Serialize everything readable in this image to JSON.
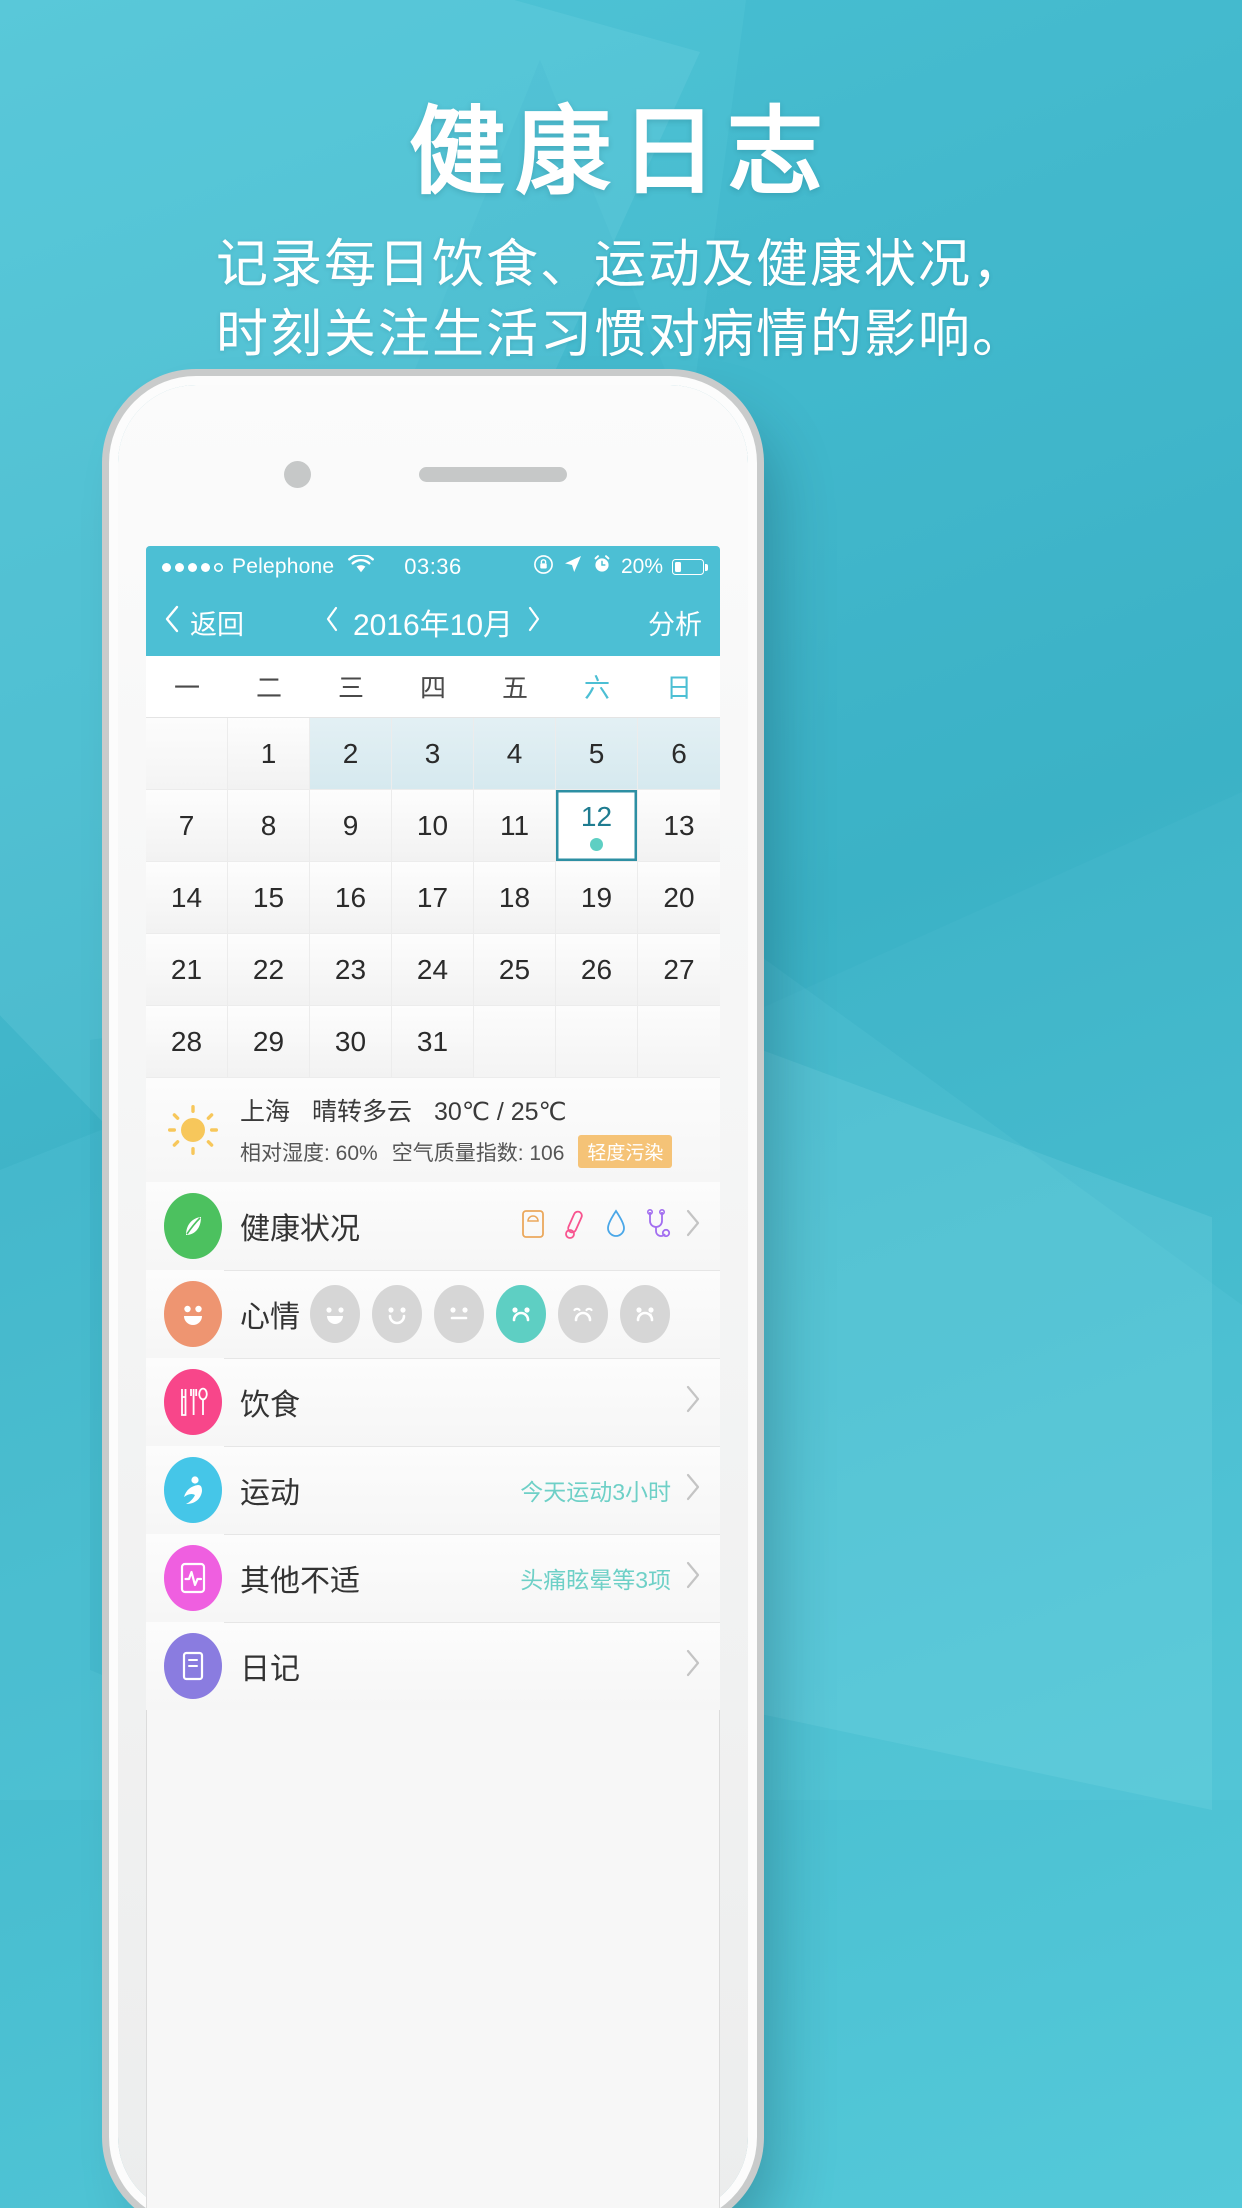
{
  "poster": {
    "title": "健康日志",
    "subtitle_line1": "记录每日饮食、运动及健康状况，",
    "subtitle_line2": "时刻关注生活习惯对病情的影响。",
    "brand_color": "#4cbfd4"
  },
  "status_bar": {
    "carrier": "Pelephone",
    "signal_dots_filled": 4,
    "signal_dots_total": 5,
    "wifi_icon": "wifi-icon",
    "time": "03:36",
    "rotation_lock_icon": "rotation-lock-icon",
    "location_icon": "location-arrow-icon",
    "alarm_icon": "alarm-clock-icon",
    "battery_percent": "20%",
    "battery_level": 20
  },
  "nav": {
    "back_label": "返回",
    "prev_month_icon": "chevron-left-icon",
    "month_title": "2016年10月",
    "next_month_icon": "chevron-right-icon",
    "action_label": "分析"
  },
  "calendar": {
    "weekdays": [
      "一",
      "二",
      "三",
      "四",
      "五",
      "六",
      "日"
    ],
    "weekend_indices": [
      5,
      6
    ],
    "leading_blanks": 1,
    "days": [
      1,
      2,
      3,
      4,
      5,
      6,
      7,
      8,
      9,
      10,
      11,
      12,
      13,
      14,
      15,
      16,
      17,
      18,
      19,
      20,
      21,
      22,
      23,
      24,
      25,
      26,
      27,
      28,
      29,
      30,
      31
    ],
    "tinted_days": [
      2,
      3,
      4,
      5,
      6
    ],
    "selected_day": 12,
    "selected_has_record": true,
    "trailing_blanks": 3,
    "selected_color": "#2d8fa3",
    "marker_color": "#5ecfc3"
  },
  "weather": {
    "icon": "sun-cloud-icon",
    "city": "上海",
    "condition": "晴转多云",
    "temperature": "30℃ / 25℃",
    "humidity_label": "相对湿度: 60%",
    "aqi_label": "空气质量指数: 106",
    "aqi_badge": "轻度污染",
    "aqi_badge_color": "#f5c377"
  },
  "rows": [
    {
      "key": "health",
      "icon": "leaf-icon",
      "icon_color": "#4cc15f",
      "label": "健康状况",
      "value": "",
      "mini_icons": [
        "weight-scale-icon",
        "thermometer-icon",
        "water-drop-icon",
        "stethoscope-icon"
      ],
      "arrow": "chevron-right-icon"
    },
    {
      "key": "mood",
      "icon": "smiley-icon",
      "icon_color": "#ee9571",
      "label": "心情",
      "value": "",
      "moods": [
        "laugh",
        "smile",
        "neutral",
        "sad",
        "cry",
        "tear"
      ],
      "selected_mood_index": 3,
      "mood_selected_color": "#5ecfc3",
      "mood_idle_color": "#d6d6d6"
    },
    {
      "key": "diet",
      "icon": "cutlery-icon",
      "icon_color": "#f8468a",
      "label": "饮食",
      "value": "",
      "arrow": "chevron-right-icon"
    },
    {
      "key": "exercise",
      "icon": "runner-icon",
      "icon_color": "#45c6e8",
      "label": "运动",
      "value": "今天运动3小时",
      "arrow": "chevron-right-icon"
    },
    {
      "key": "discomfort",
      "icon": "pulse-monitor-icon",
      "icon_color": "#ef5fe0",
      "label": "其他不适",
      "value": "头痛眩晕等3项",
      "arrow": "chevron-right-icon"
    },
    {
      "key": "diary",
      "icon": "notebook-icon",
      "icon_color": "#8a7ce0",
      "label": "日记",
      "value": "",
      "arrow": "chevron-right-icon"
    }
  ],
  "value_color": "#6ed0c7"
}
